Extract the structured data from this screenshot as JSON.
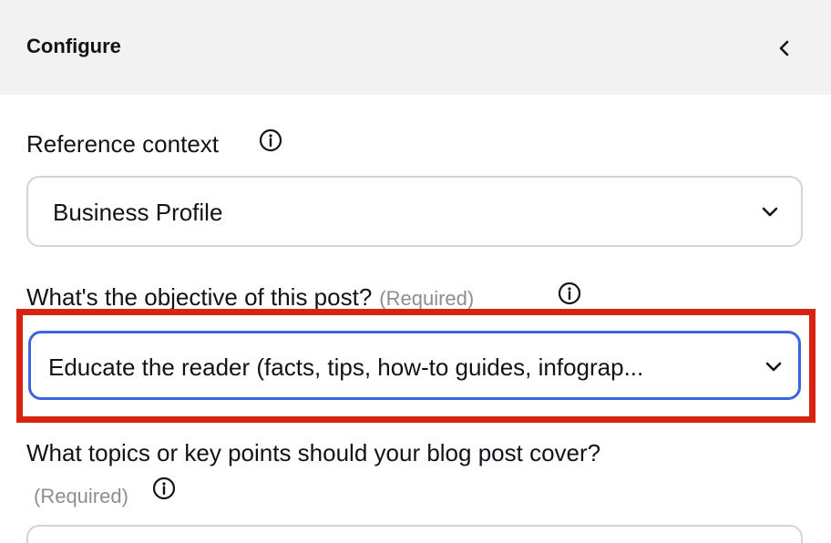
{
  "header": {
    "title": "Configure",
    "collapse_icon": "chevron-left-icon"
  },
  "fields": {
    "reference_context": {
      "label": "Reference context",
      "value": "Business Profile"
    },
    "objective": {
      "label": "What's the objective of this post?",
      "required": "(Required)",
      "value": "Educate the reader (facts, tips, how-to guides, infograp..."
    },
    "topics": {
      "label": "What topics or key points should your blog post cover?",
      "required": "(Required)"
    }
  },
  "colors": {
    "header_bg": "#f2f2f3",
    "focus_border": "#3b66e0",
    "highlight_border": "#d62410",
    "muted_text": "#8b8e96"
  }
}
